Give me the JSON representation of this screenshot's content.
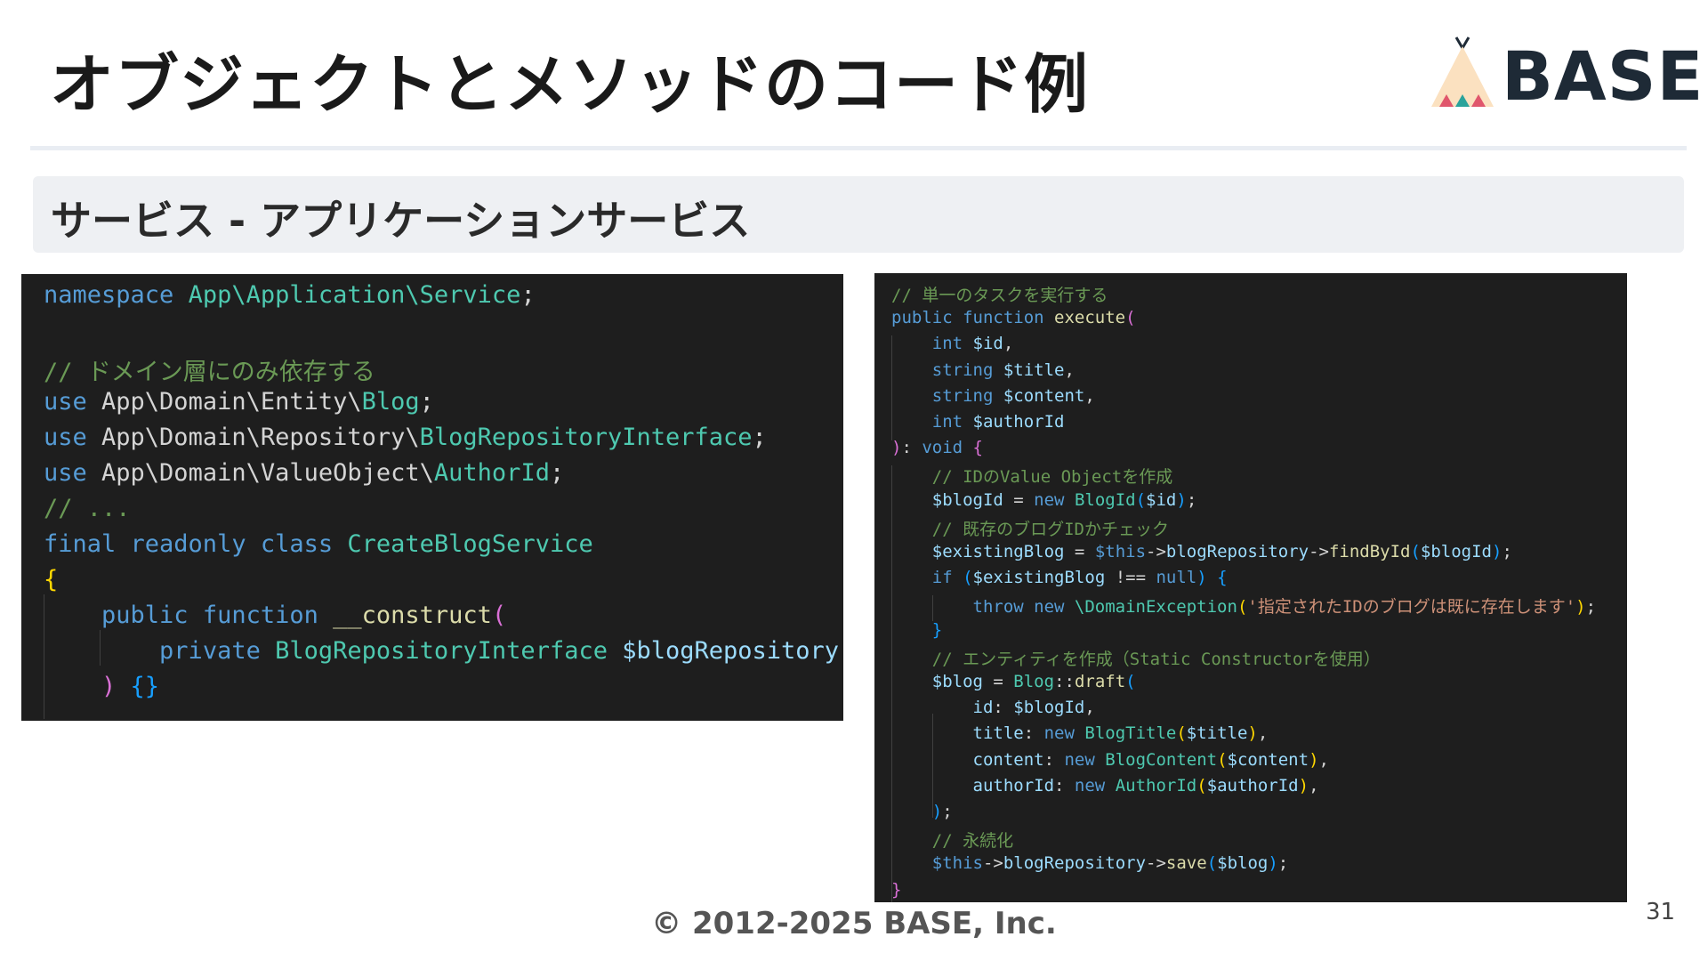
{
  "slide": {
    "title": "オブジェクトとメソッドのコード例",
    "subtitle": "サービス - アプリケーションサービス",
    "footer": "© 2012-2025 BASE, Inc.",
    "page_number": "31"
  },
  "logo": {
    "text": "BASE",
    "icon": "tent-icon"
  },
  "colors": {
    "code_background": "#1e1e1e",
    "keyword": "#569cd6",
    "type": "#4ec9b0",
    "function": "#dcdcaa",
    "variable": "#9cdcfe",
    "comment": "#6a9955",
    "string": "#ce9178",
    "logo_text": "#1e2a36"
  },
  "left_code": {
    "lines": [
      [
        [
          "kw",
          "namespace "
        ],
        [
          "type",
          "App\\Application\\Service"
        ],
        [
          "plain",
          ";"
        ]
      ],
      [],
      [
        [
          "cmt",
          "// ドメイン層にのみ依存する"
        ]
      ],
      [
        [
          "kw",
          "use "
        ],
        [
          "plain",
          "App\\Domain\\Entity\\"
        ],
        [
          "type",
          "Blog"
        ],
        [
          "plain",
          ";"
        ]
      ],
      [
        [
          "kw",
          "use "
        ],
        [
          "plain",
          "App\\Domain\\Repository\\"
        ],
        [
          "type",
          "BlogRepositoryInterface"
        ],
        [
          "plain",
          ";"
        ]
      ],
      [
        [
          "kw",
          "use "
        ],
        [
          "plain",
          "App\\Domain\\ValueObject\\"
        ],
        [
          "type",
          "AuthorId"
        ],
        [
          "plain",
          ";"
        ]
      ],
      [
        [
          "cmt",
          "// ..."
        ]
      ],
      [
        [
          "kw",
          "final readonly class "
        ],
        [
          "type",
          "CreateBlogService"
        ]
      ],
      [
        [
          "brace",
          "{"
        ]
      ],
      [
        [
          "plain",
          "    "
        ],
        [
          "kw",
          "public function "
        ],
        [
          "fn",
          "__construct"
        ],
        [
          "paren",
          "("
        ]
      ],
      [
        [
          "plain",
          "        "
        ],
        [
          "kw",
          "private "
        ],
        [
          "type",
          "BlogRepositoryInterface "
        ],
        [
          "var",
          "$blogRepository"
        ]
      ],
      [
        [
          "plain",
          "    "
        ],
        [
          "paren",
          ") "
        ],
        [
          "paren2",
          "{}"
        ]
      ]
    ]
  },
  "right_code": {
    "lines": [
      [
        [
          "cmt",
          "// 単一のタスクを実行する"
        ]
      ],
      [
        [
          "kw",
          "public function "
        ],
        [
          "fn",
          "execute"
        ],
        [
          "paren",
          "("
        ]
      ],
      [
        [
          "plain",
          "    "
        ],
        [
          "kw",
          "int "
        ],
        [
          "var",
          "$id"
        ],
        [
          "plain",
          ","
        ]
      ],
      [
        [
          "plain",
          "    "
        ],
        [
          "kw",
          "string "
        ],
        [
          "var",
          "$title"
        ],
        [
          "plain",
          ","
        ]
      ],
      [
        [
          "plain",
          "    "
        ],
        [
          "kw",
          "string "
        ],
        [
          "var",
          "$content"
        ],
        [
          "plain",
          ","
        ]
      ],
      [
        [
          "plain",
          "    "
        ],
        [
          "kw",
          "int "
        ],
        [
          "var",
          "$authorId"
        ]
      ],
      [
        [
          "paren",
          ")"
        ],
        [
          "plain",
          ": "
        ],
        [
          "kw",
          "void "
        ],
        [
          "paren",
          "{"
        ]
      ],
      [
        [
          "plain",
          "    "
        ],
        [
          "cmt",
          "// IDのValue Objectを作成"
        ]
      ],
      [
        [
          "plain",
          "    "
        ],
        [
          "var",
          "$blogId"
        ],
        [
          "plain",
          " = "
        ],
        [
          "kw",
          "new "
        ],
        [
          "type",
          "BlogId"
        ],
        [
          "paren2",
          "("
        ],
        [
          "var",
          "$id"
        ],
        [
          "paren2",
          ")"
        ],
        [
          "plain",
          ";"
        ]
      ],
      [
        [
          "plain",
          "    "
        ],
        [
          "cmt",
          "// 既存のブログIDかチェック"
        ]
      ],
      [
        [
          "plain",
          "    "
        ],
        [
          "var",
          "$existingBlog"
        ],
        [
          "plain",
          " = "
        ],
        [
          "kw",
          "$this"
        ],
        [
          "plain",
          "->"
        ],
        [
          "var",
          "blogRepository"
        ],
        [
          "plain",
          "->"
        ],
        [
          "fn",
          "findById"
        ],
        [
          "paren2",
          "("
        ],
        [
          "var",
          "$blogId"
        ],
        [
          "paren2",
          ")"
        ],
        [
          "plain",
          ";"
        ]
      ],
      [
        [
          "plain",
          "    "
        ],
        [
          "kw",
          "if "
        ],
        [
          "paren2",
          "("
        ],
        [
          "var",
          "$existingBlog"
        ],
        [
          "plain",
          " !== "
        ],
        [
          "kw",
          "null"
        ],
        [
          "paren2",
          ") {"
        ]
      ],
      [
        [
          "plain",
          "        "
        ],
        [
          "kw",
          "throw new "
        ],
        [
          "type",
          "\\DomainException"
        ],
        [
          "brace",
          "("
        ],
        [
          "str",
          "'指定されたIDのブログは既に存在します'"
        ],
        [
          "brace",
          ")"
        ],
        [
          "plain",
          ";"
        ]
      ],
      [
        [
          "plain",
          "    "
        ],
        [
          "paren2",
          "}"
        ]
      ],
      [
        [
          "plain",
          "    "
        ],
        [
          "cmt",
          "// エンティティを作成（Static Constructorを使用）"
        ]
      ],
      [
        [
          "plain",
          "    "
        ],
        [
          "var",
          "$blog"
        ],
        [
          "plain",
          " = "
        ],
        [
          "type",
          "Blog"
        ],
        [
          "plain",
          "::"
        ],
        [
          "fn",
          "draft"
        ],
        [
          "paren2",
          "("
        ]
      ],
      [
        [
          "plain",
          "        "
        ],
        [
          "var",
          "id"
        ],
        [
          "plain",
          ": "
        ],
        [
          "var",
          "$blogId"
        ],
        [
          "plain",
          ","
        ]
      ],
      [
        [
          "plain",
          "        "
        ],
        [
          "var",
          "title"
        ],
        [
          "plain",
          ": "
        ],
        [
          "kw",
          "new "
        ],
        [
          "type",
          "BlogTitle"
        ],
        [
          "brace",
          "("
        ],
        [
          "var",
          "$title"
        ],
        [
          "brace",
          ")"
        ],
        [
          "plain",
          ","
        ]
      ],
      [
        [
          "plain",
          "        "
        ],
        [
          "var",
          "content"
        ],
        [
          "plain",
          ": "
        ],
        [
          "kw",
          "new "
        ],
        [
          "type",
          "BlogContent"
        ],
        [
          "brace",
          "("
        ],
        [
          "var",
          "$content"
        ],
        [
          "brace",
          ")"
        ],
        [
          "plain",
          ","
        ]
      ],
      [
        [
          "plain",
          "        "
        ],
        [
          "var",
          "authorId"
        ],
        [
          "plain",
          ": "
        ],
        [
          "kw",
          "new "
        ],
        [
          "type",
          "AuthorId"
        ],
        [
          "brace",
          "("
        ],
        [
          "var",
          "$authorId"
        ],
        [
          "brace",
          ")"
        ],
        [
          "plain",
          ","
        ]
      ],
      [
        [
          "plain",
          "    "
        ],
        [
          "paren2",
          ")"
        ],
        [
          "plain",
          ";"
        ]
      ],
      [
        [
          "plain",
          "    "
        ],
        [
          "cmt",
          "// 永続化"
        ]
      ],
      [
        [
          "plain",
          "    "
        ],
        [
          "kw",
          "$this"
        ],
        [
          "plain",
          "->"
        ],
        [
          "var",
          "blogRepository"
        ],
        [
          "plain",
          "->"
        ],
        [
          "fn",
          "save"
        ],
        [
          "paren2",
          "("
        ],
        [
          "var",
          "$blog"
        ],
        [
          "paren2",
          ")"
        ],
        [
          "plain",
          ";"
        ]
      ],
      [
        [
          "paren",
          "}"
        ]
      ]
    ]
  }
}
